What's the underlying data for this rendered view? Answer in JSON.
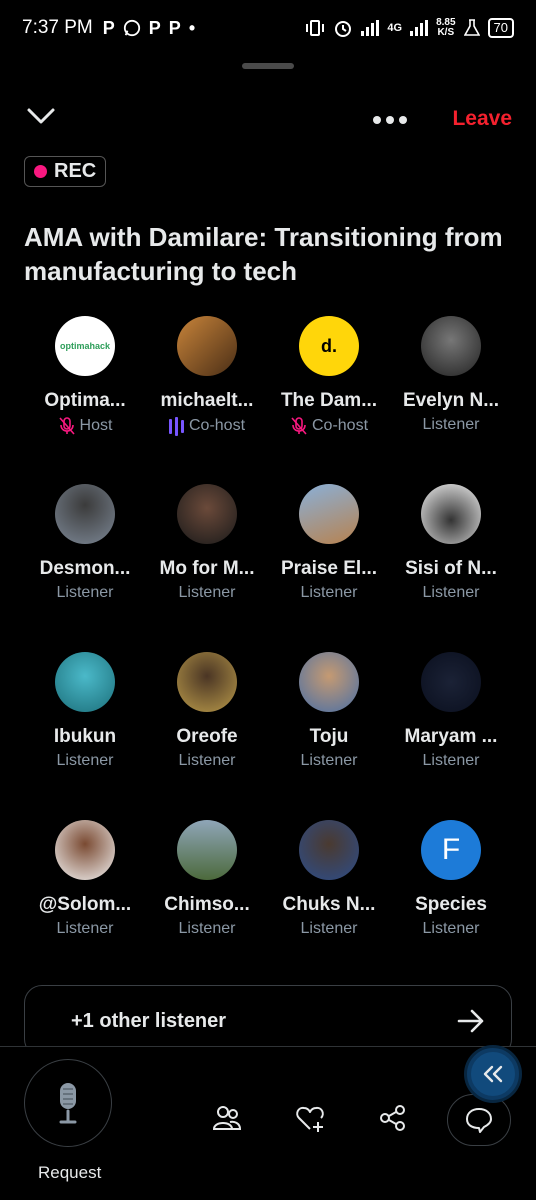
{
  "status_bar": {
    "time": "7:37 PM",
    "left_icons": [
      "P",
      "whatsapp-icon",
      "P",
      "P",
      "•"
    ],
    "network": "4G",
    "speed": "8.85",
    "speed_unit": "K/S",
    "battery": "70"
  },
  "header": {
    "leave_label": "Leave",
    "rec_label": "REC"
  },
  "space": {
    "title": "AMA with Damilare: Transitioning from manufacturing to tech"
  },
  "participants": [
    {
      "name": "Optima...",
      "role": "Host",
      "role_icon": "mic-off-icon"
    },
    {
      "name": "michaelt...",
      "role": "Co-host",
      "role_icon": "speaking-bars-icon"
    },
    {
      "name": "The Dam...",
      "role": "Co-host",
      "role_icon": "mic-off-icon"
    },
    {
      "name": "Evelyn N...",
      "role": "Listener",
      "role_icon": ""
    },
    {
      "name": "Desmon...",
      "role": "Listener",
      "role_icon": ""
    },
    {
      "name": "Mo for M...",
      "role": "Listener",
      "role_icon": ""
    },
    {
      "name": "Praise El...",
      "role": "Listener",
      "role_icon": ""
    },
    {
      "name": "Sisi of N...",
      "role": "Listener",
      "role_icon": ""
    },
    {
      "name": "Ibukun",
      "role": "Listener",
      "role_icon": ""
    },
    {
      "name": "Oreofe",
      "role": "Listener",
      "role_icon": ""
    },
    {
      "name": "Toju",
      "role": "Listener",
      "role_icon": ""
    },
    {
      "name": "Maryam ...",
      "role": "Listener",
      "role_icon": ""
    },
    {
      "name": "@Solom...",
      "role": "Listener",
      "role_icon": ""
    },
    {
      "name": "Chimso...",
      "role": "Listener",
      "role_icon": ""
    },
    {
      "name": "Chuks N...",
      "role": "Listener",
      "role_icon": ""
    },
    {
      "name": "Species",
      "role": "Listener",
      "role_icon": ""
    }
  ],
  "avatar_text": {
    "optima": "optimahack",
    "the_dam": "d.",
    "species": "F"
  },
  "other_listeners": {
    "label": "+1 other listener"
  },
  "bottom_bar": {
    "request_label": "Request"
  },
  "colors": {
    "accent_leave": "#f4212e",
    "rec_dot": "#f91880",
    "cohost_bars": "#7856ff",
    "muted_icon": "#f91880",
    "secondary_text": "#8b98a5"
  }
}
